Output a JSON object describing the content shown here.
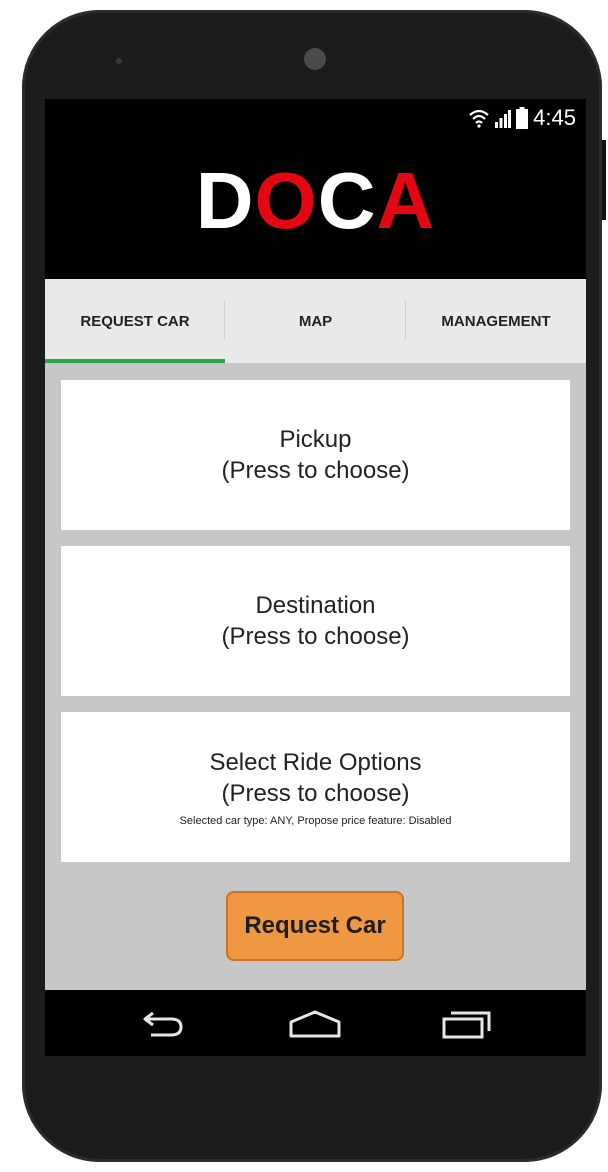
{
  "status_bar": {
    "time": "4:45",
    "icons": [
      "wifi-icon",
      "signal-icon",
      "battery-icon"
    ]
  },
  "header": {
    "logo_letters": [
      {
        "char": "D",
        "color": "#ffffff"
      },
      {
        "char": "O",
        "color": "#e30613"
      },
      {
        "char": "C",
        "color": "#ffffff"
      },
      {
        "char": "A",
        "color": "#e30613"
      }
    ]
  },
  "tabs": [
    {
      "label": "REQUEST CAR",
      "active": true
    },
    {
      "label": "MAP",
      "active": false
    },
    {
      "label": "MANAGEMENT",
      "active": false
    }
  ],
  "cards": {
    "pickup": {
      "title": "Pickup",
      "sub": "(Press to choose)"
    },
    "destination": {
      "title": "Destination",
      "sub": "(Press to choose)"
    },
    "ride_options": {
      "title": "Select Ride Options",
      "sub": "(Press to choose)",
      "note": "Selected car type: ANY, Propose price feature: Disabled"
    }
  },
  "request_button": {
    "label": "Request Car"
  },
  "nav_bar": {
    "icons": [
      "back-icon",
      "home-icon",
      "recent-apps-icon"
    ]
  },
  "colors": {
    "accent_green": "#2fa44f",
    "brand_red": "#e30613",
    "button_orange": "#ef9841",
    "content_bg": "#c7c7c7"
  }
}
